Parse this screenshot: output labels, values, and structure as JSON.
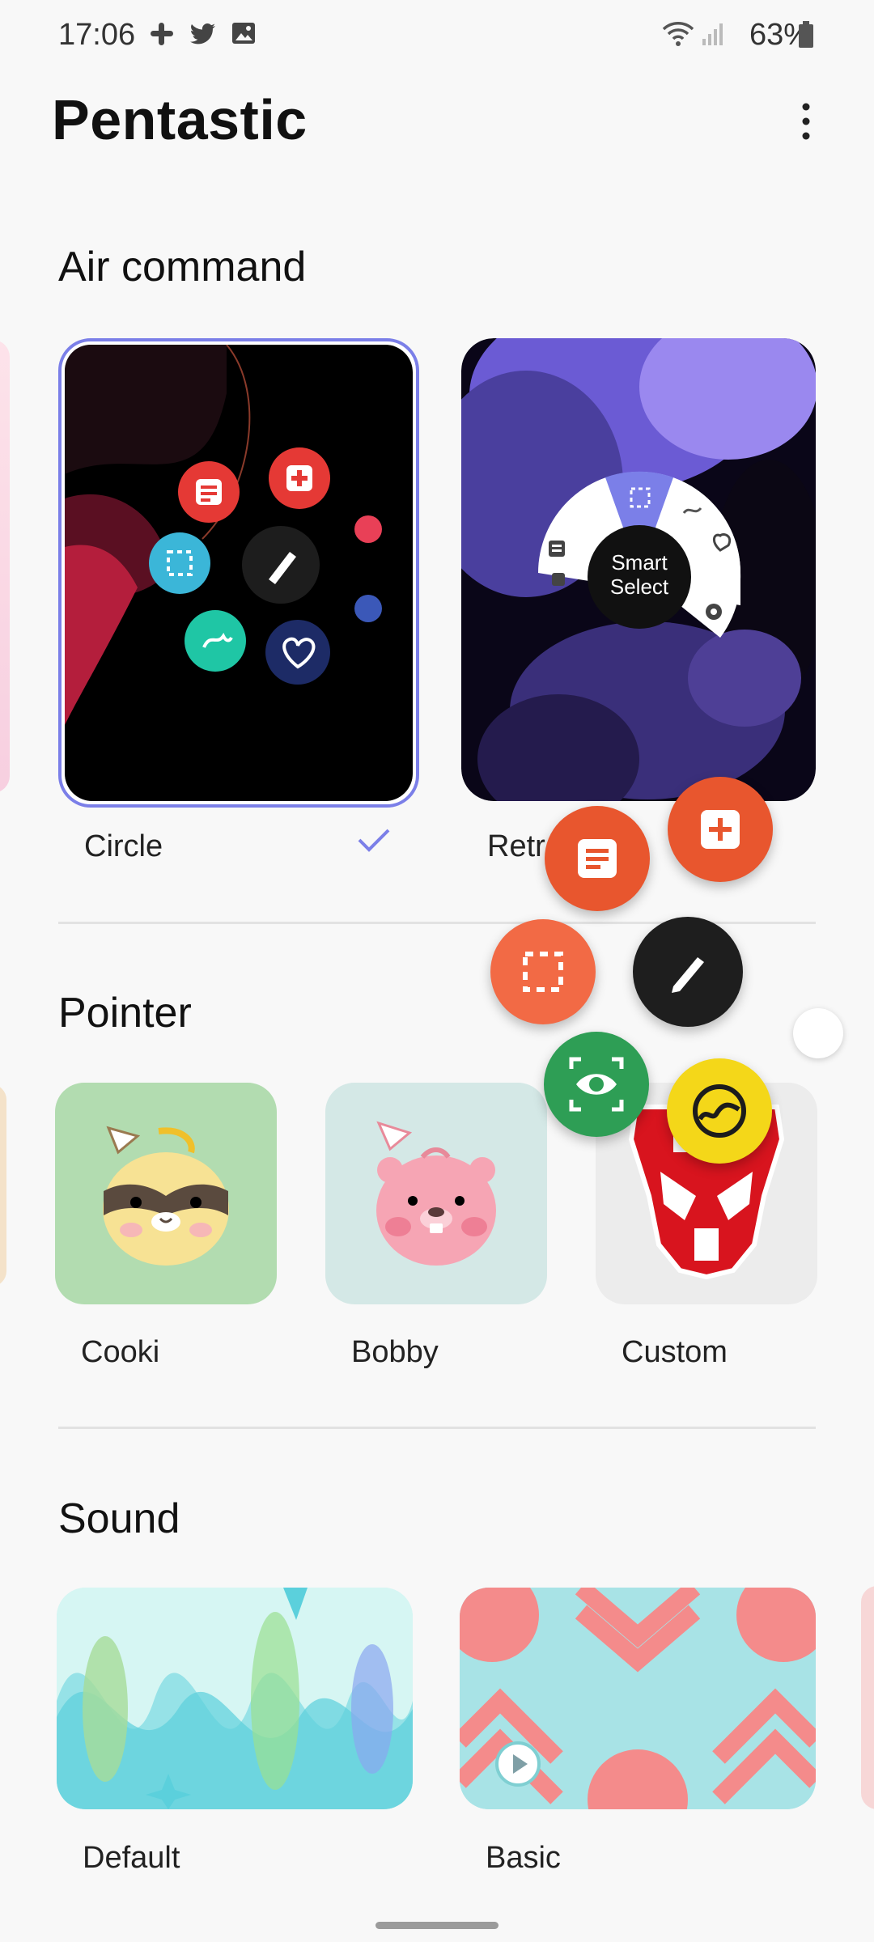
{
  "status_bar": {
    "time": "17:06",
    "battery": "63%"
  },
  "app": {
    "title": "Pentastic"
  },
  "air_command": {
    "title": "Air command",
    "styles": [
      {
        "label": "Circle",
        "selected": true
      },
      {
        "label": "Retro",
        "visible_text": "Retr",
        "center_text": "Smart Select"
      }
    ]
  },
  "pointer": {
    "title": "Pointer",
    "items": [
      {
        "label": "Cooki"
      },
      {
        "label": "Bobby"
      },
      {
        "label": "Custom"
      }
    ]
  },
  "sound": {
    "title": "Sound",
    "items": [
      {
        "label": "Default"
      },
      {
        "label": "Basic"
      }
    ]
  },
  "colors": {
    "accent": "#7b7fe8",
    "fab_orange": "#e8562e",
    "fab_black": "#1e1e1e",
    "fab_green": "#2e9e55",
    "fab_yellow": "#f4d719"
  }
}
